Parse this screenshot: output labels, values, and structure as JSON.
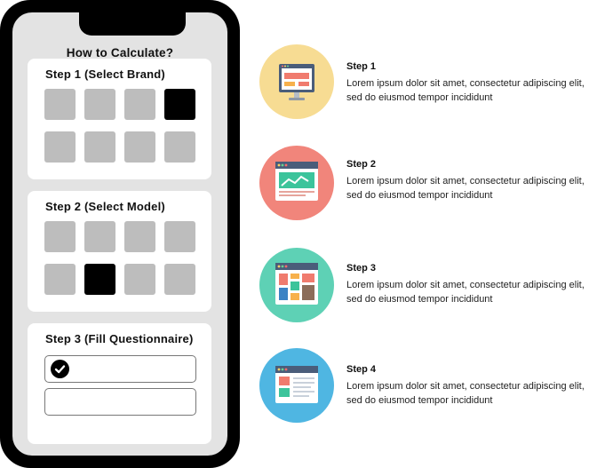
{
  "phone": {
    "title": "How to Calculate?",
    "cards": [
      {
        "title": "Step 1 (Select Brand)",
        "tiles": 8,
        "selected_index": 3
      },
      {
        "title": "Step 2 (Select Model)",
        "tiles": 8,
        "selected_index": 5
      },
      {
        "title": "Step 3 (Fill Questionnaire)",
        "fields": [
          {
            "checked": true
          },
          {
            "checked": false
          }
        ]
      }
    ]
  },
  "steps": [
    {
      "label": "Step 1",
      "description": "Lorem ipsum dolor sit amet, consectetur adipiscing elit, sed do eiusmod tempor incididunt",
      "icon": "monitor-icon",
      "color": "#f7dc93"
    },
    {
      "label": "Step 2",
      "description": "Lorem ipsum dolor sit amet, consectetur adipiscing elit, sed do eiusmod tempor incididunt",
      "icon": "browser-chart-icon",
      "color": "#f1857b"
    },
    {
      "label": "Step 3",
      "description": "Lorem ipsum dolor sit amet, consectetur adipiscing elit, sed do eiusmod tempor incididunt",
      "icon": "browser-grid-icon",
      "color": "#5ed1b5"
    },
    {
      "label": "Step 4",
      "description": "Lorem ipsum dolor sit amet, consectetur adipiscing elit, sed do eiusmod tempor incididunt",
      "icon": "browser-layout-icon",
      "color": "#4fb6e2"
    }
  ]
}
